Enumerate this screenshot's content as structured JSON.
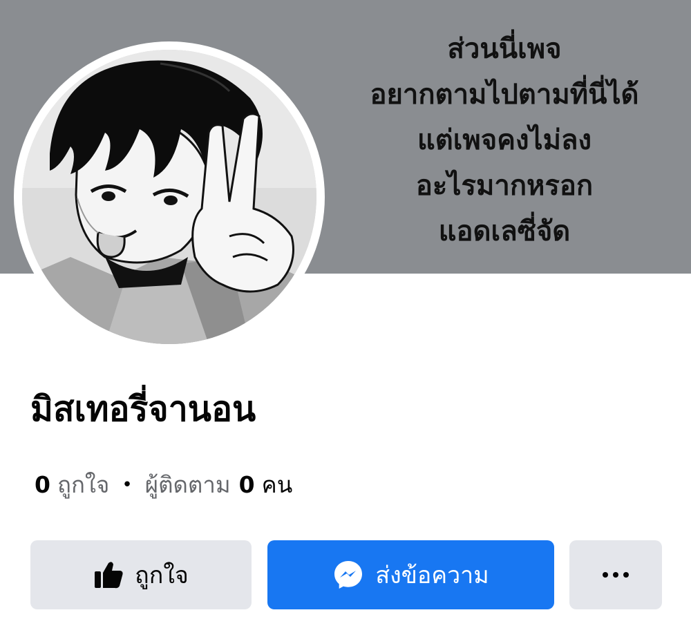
{
  "cover": {
    "lines": [
      "ส่วนนี่เพจ",
      "อยากตามไปตามที่นี่ได้",
      "แต่เพจคงไม่ลง",
      "อะไรมากหรอก",
      "แอดเลซี่จัด"
    ]
  },
  "profile": {
    "name": "มิสเทอรี่จานอน",
    "likes_count": "0",
    "likes_label": "ถูกใจ",
    "separator": "•",
    "followers_label": "ผู้ติดตาม",
    "followers_count": "0",
    "followers_unit": "คน"
  },
  "actions": {
    "like_label": "ถูกใจ",
    "message_label": "ส่งข้อความ",
    "like_icon": "thumbs-up-icon",
    "message_icon": "messenger-icon",
    "more_icon": "more-horizontal-icon"
  },
  "colors": {
    "cover_bg": "#8a8d91",
    "primary": "#1877f2",
    "secondary_button": "#e4e6eb",
    "muted_text": "#65676b"
  }
}
